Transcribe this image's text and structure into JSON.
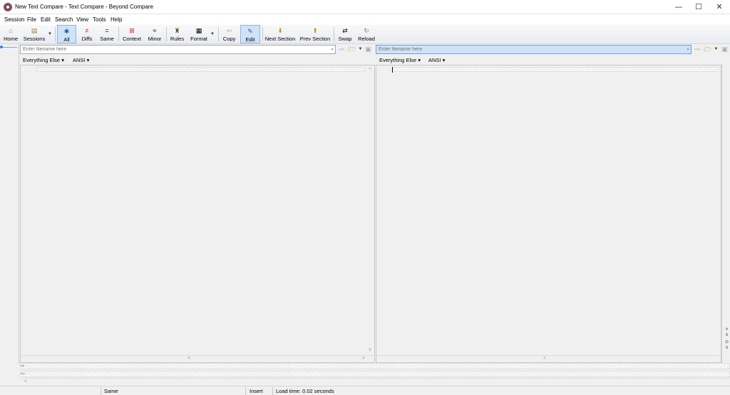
{
  "window": {
    "title": "New Text Compare - Text Compare - Beyond Compare"
  },
  "window_controls": {
    "minimize": "—",
    "maximize": "☐",
    "close": "✕"
  },
  "menu": [
    "Session",
    "File",
    "Edit",
    "Search",
    "View",
    "Tools",
    "Help"
  ],
  "toolbar": {
    "home": "Home",
    "sessions": "Sessions",
    "all": "All",
    "diffs": "Diffs",
    "same": "Same",
    "context": "Context",
    "minor": "Minor",
    "rules": "Rules",
    "format": "Format",
    "copy": "Copy",
    "edit": "Edit",
    "next_section": "Next Section",
    "prev_section": "Prev Section",
    "swap": "Swap",
    "reload": "Reload",
    "active": [
      "All",
      "Edit"
    ]
  },
  "left_file": {
    "placeholder": "Enter filename here",
    "format": "Everything Else",
    "encoding": "ANSI"
  },
  "right_file": {
    "placeholder": "Enter filename here",
    "format": "Everything Else",
    "encoding": "ANSI"
  },
  "status": {
    "comparison": "Same",
    "mode": "Insert",
    "load_time": "Load time: 0.02 seconds"
  },
  "colors": {
    "active_button": "#cfe2f7",
    "focused_input": "#cfe2f7"
  }
}
